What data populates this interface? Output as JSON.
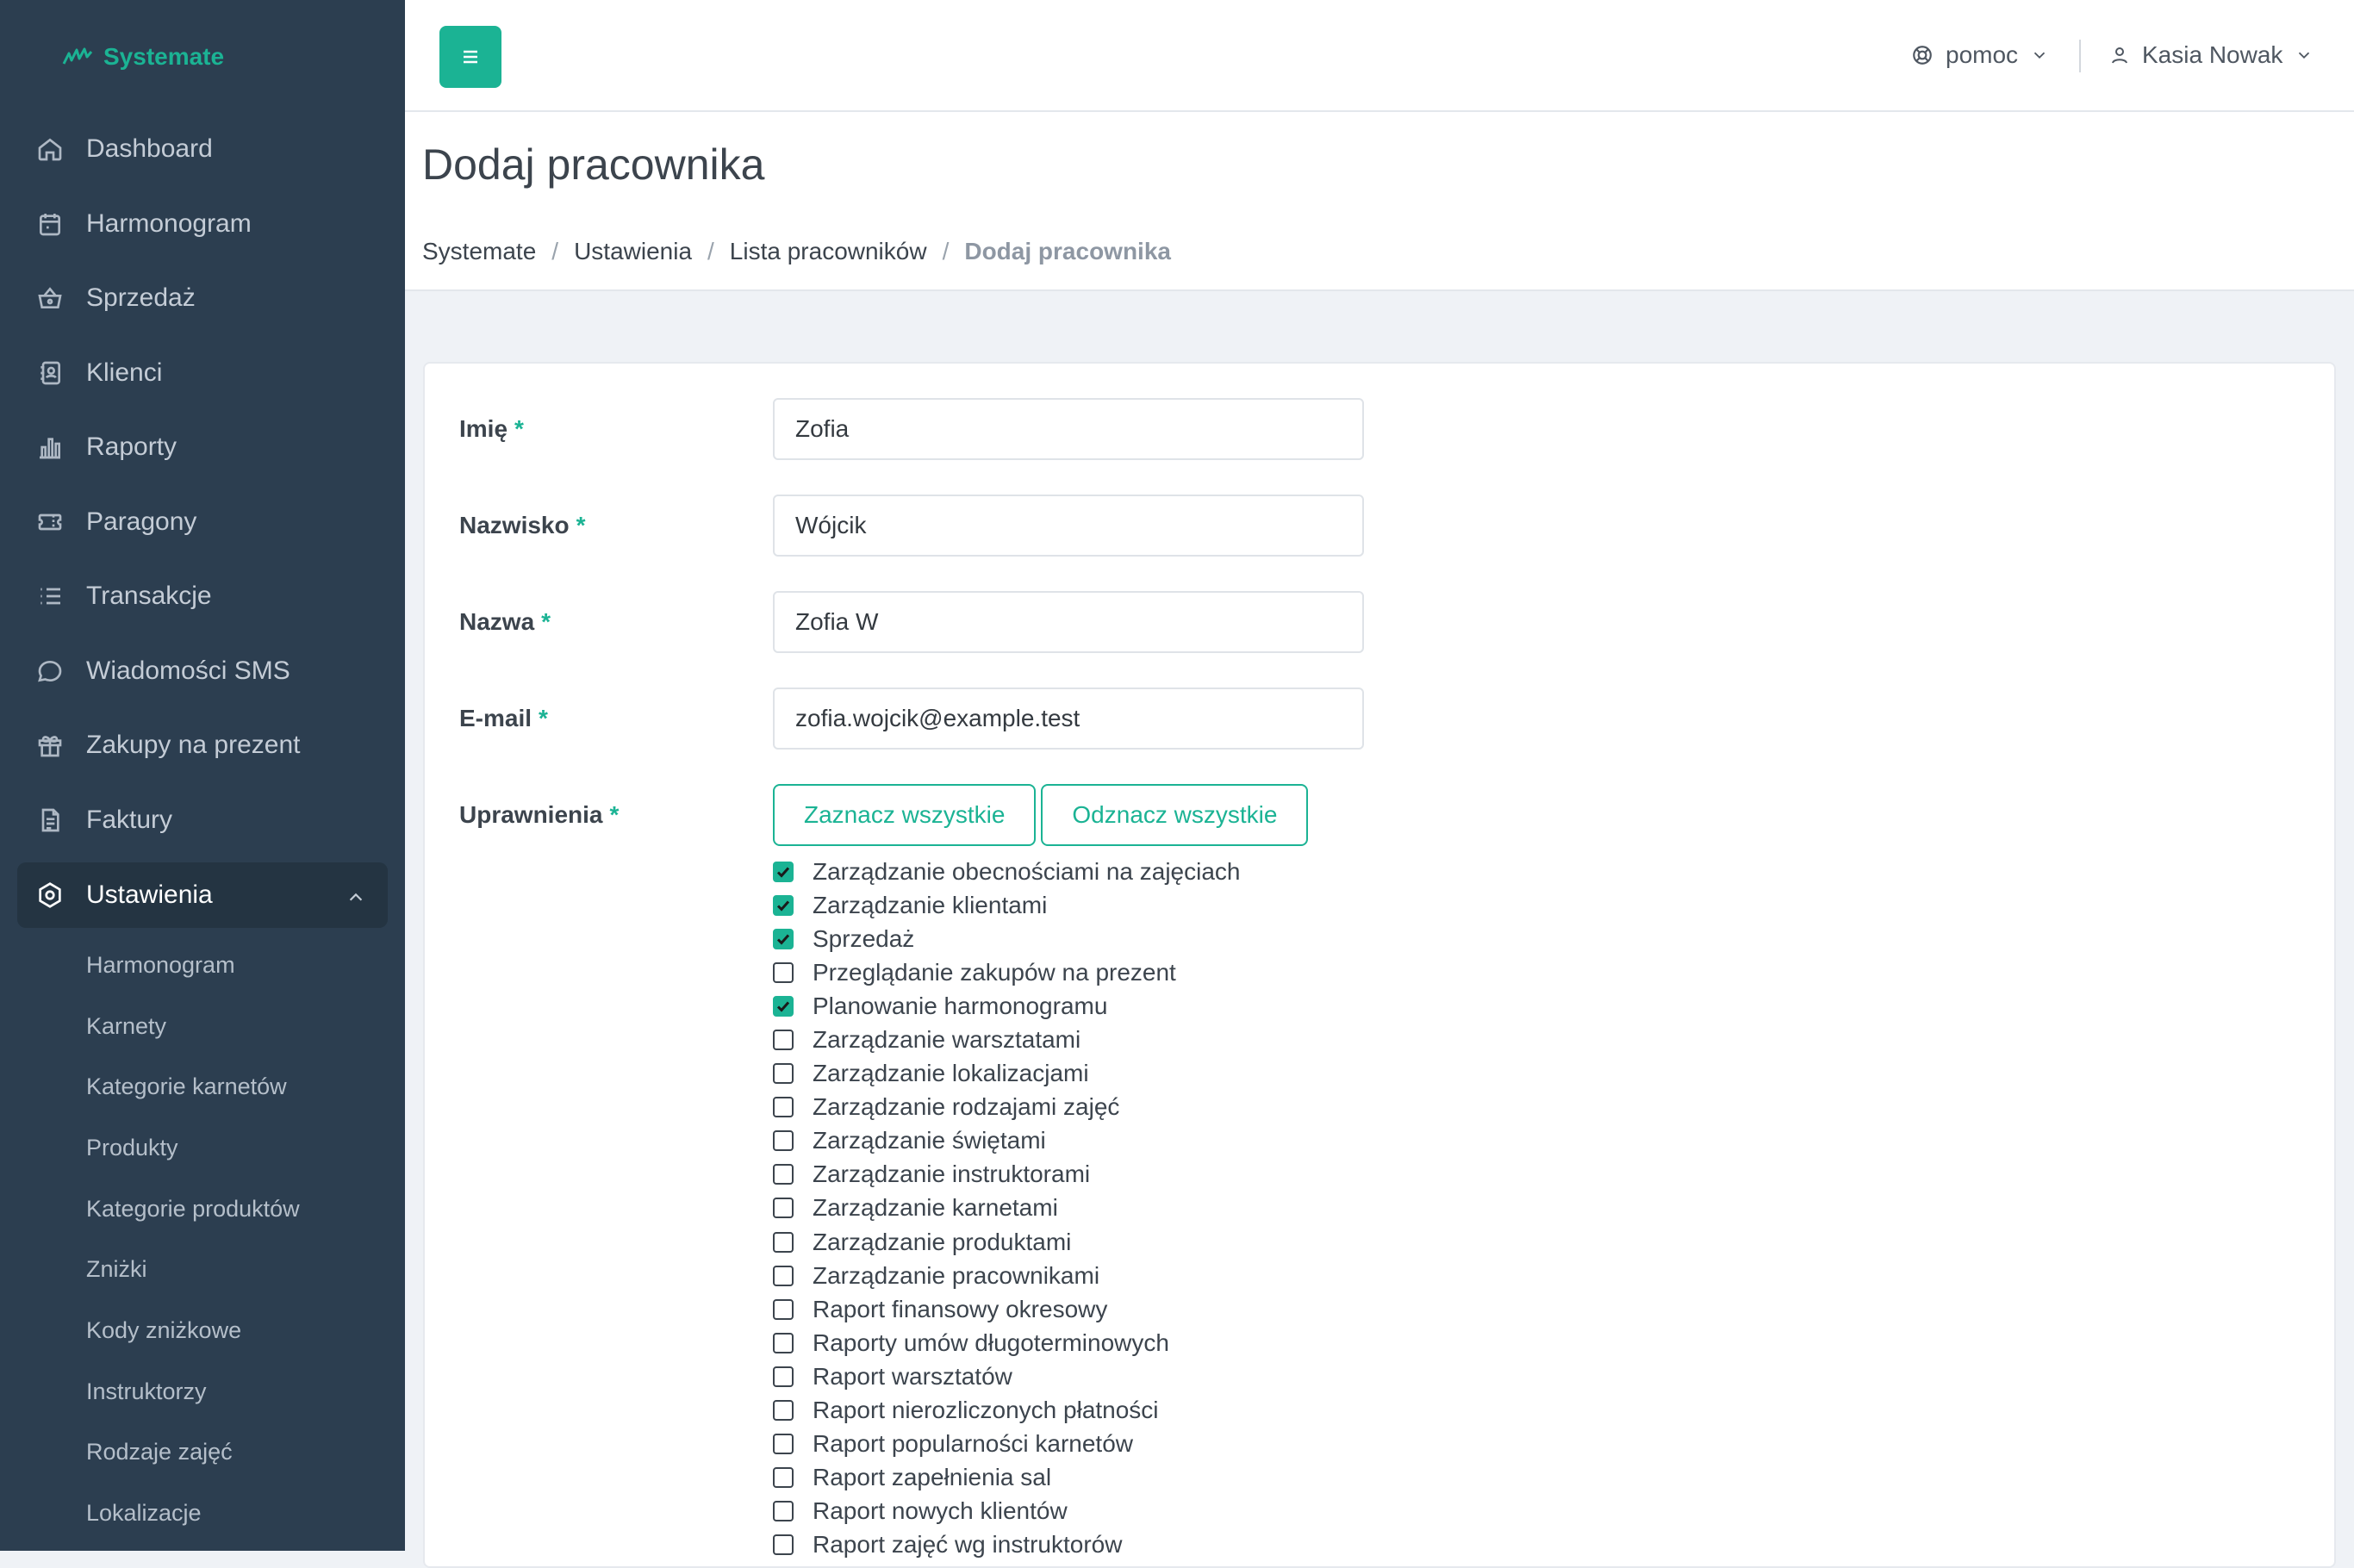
{
  "brand": {
    "name": "Systemate",
    "accent": "#1bb394"
  },
  "sidebar": {
    "items": [
      {
        "label": "Dashboard",
        "icon": "home-icon"
      },
      {
        "label": "Harmonogram",
        "icon": "calendar-icon"
      },
      {
        "label": "Sprzedaż",
        "icon": "basket-icon"
      },
      {
        "label": "Klienci",
        "icon": "contacts-icon"
      },
      {
        "label": "Raporty",
        "icon": "bar-chart-icon"
      },
      {
        "label": "Paragony",
        "icon": "ticket-icon"
      },
      {
        "label": "Transakcje",
        "icon": "list-icon"
      },
      {
        "label": "Wiadomości SMS",
        "icon": "chat-icon"
      },
      {
        "label": "Zakupy na prezent",
        "icon": "gift-icon"
      },
      {
        "label": "Faktury",
        "icon": "document-icon"
      }
    ],
    "active": {
      "label": "Ustawienia",
      "icon": "settings-icon"
    },
    "subitems": [
      "Harmonogram",
      "Karnety",
      "Kategorie karnetów",
      "Produkty",
      "Kategorie produktów",
      "Zniżki",
      "Kody zniżkowe",
      "Instruktorzy",
      "Rodzaje zajęć",
      "Lokalizacje"
    ]
  },
  "topbar": {
    "help_label": "pomoc",
    "user_name": "Kasia Nowak"
  },
  "page": {
    "title": "Dodaj pracownika",
    "breadcrumb": [
      "Systemate",
      "Ustawienia",
      "Lista pracowników",
      "Dodaj pracownika"
    ]
  },
  "form": {
    "first_name": {
      "label": "Imię",
      "value": "Zofia"
    },
    "last_name": {
      "label": "Nazwisko",
      "value": "Wójcik"
    },
    "display_name": {
      "label": "Nazwa",
      "value": "Zofia W"
    },
    "email": {
      "label": "E-mail",
      "value": "zofia.wojcik@example.test"
    },
    "permissions_label": "Uprawnienia",
    "required_mark": "*",
    "select_all_label": "Zaznacz wszystkie",
    "deselect_all_label": "Odznacz wszystkie",
    "permissions": [
      {
        "label": "Zarządzanie obecnościami na zajęciach",
        "checked": true
      },
      {
        "label": "Zarządzanie klientami",
        "checked": true
      },
      {
        "label": "Sprzedaż",
        "checked": true
      },
      {
        "label": "Przeglądanie zakupów na prezent",
        "checked": false
      },
      {
        "label": "Planowanie harmonogramu",
        "checked": true
      },
      {
        "label": "Zarządzanie warsztatami",
        "checked": false
      },
      {
        "label": "Zarządzanie lokalizacjami",
        "checked": false
      },
      {
        "label": "Zarządzanie rodzajami zajęć",
        "checked": false
      },
      {
        "label": "Zarządzanie świętami",
        "checked": false
      },
      {
        "label": "Zarządzanie instruktorami",
        "checked": false
      },
      {
        "label": "Zarządzanie karnetami",
        "checked": false
      },
      {
        "label": "Zarządzanie produktami",
        "checked": false
      },
      {
        "label": "Zarządzanie pracownikami",
        "checked": false
      },
      {
        "label": "Raport finansowy okresowy",
        "checked": false
      },
      {
        "label": "Raporty umów długoterminowych",
        "checked": false
      },
      {
        "label": "Raport warsztatów",
        "checked": false
      },
      {
        "label": "Raport nierozliczonych płatności",
        "checked": false
      },
      {
        "label": "Raport popularności karnetów",
        "checked": false
      },
      {
        "label": "Raport zapełnienia sal",
        "checked": false
      },
      {
        "label": "Raport nowych klientów",
        "checked": false
      },
      {
        "label": "Raport zajęć wg instruktorów",
        "checked": false
      }
    ]
  }
}
